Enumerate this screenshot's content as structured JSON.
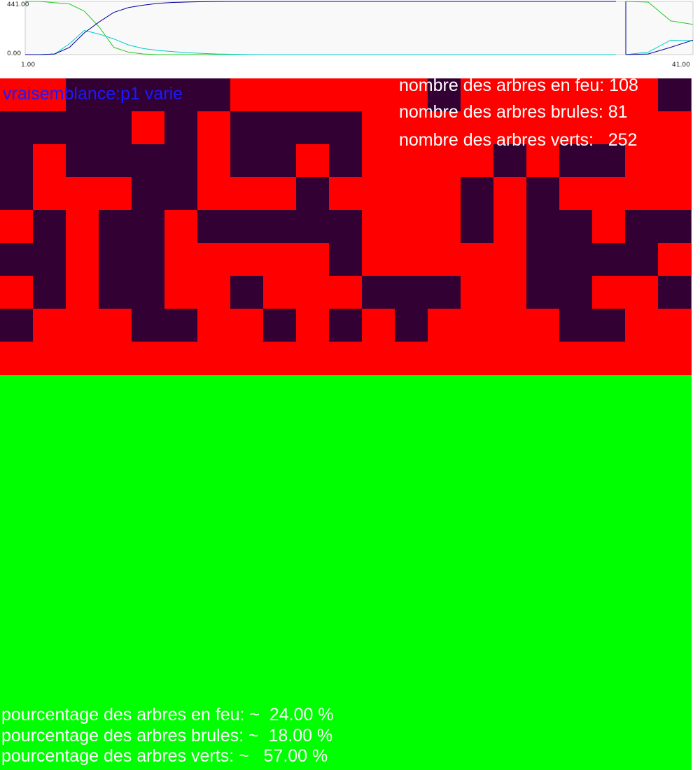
{
  "colors": {
    "fire": "#ff0000",
    "burned": "#330033",
    "green": "#00ff00",
    "title_text": "#1a1aff",
    "overlay_text": "#ffffff"
  },
  "title": "vraisemblance:p1 varie",
  "counts": {
    "fire": "nombre des arbres en feu: 108",
    "burned": "nombre des arbres brules: 81",
    "green": "nombre des arbres verts:   252"
  },
  "percentages": {
    "fire": "pourcentage des arbres en feu: ~  24.00 %",
    "burned": "pourcentage des arbres brules: ~  18.00 %",
    "green": "pourcentage des arbres verts: ~   57.00 %"
  },
  "grid": {
    "cols": 21,
    "rows": [
      "FFBBBBBFFFFFFBFFFFFFB",
      "BBBBFBFBBBBFFFFFFFFFF",
      "BFBBBBFBBFBFFFFBFBBFF",
      "BFFFBBFFFBFFFFBFBFFFF",
      "FBFBBFBBBBBFFFBFBBFBB",
      "BBFBBFFFFFBFFFFFBBBBF",
      "FBFBBFFBFFFBBBFFBBFFB",
      "BFFFBBFFBFBFBFFFFBBFF",
      "FFFFFFFFFFFFFFFFFFFFF"
    ]
  },
  "chart_data": {
    "type": "line",
    "ylim": [
      0,
      441
    ],
    "xlim": [
      1,
      41
    ],
    "y_ticks": [
      "441.00",
      "0.00"
    ],
    "x_ticks": [
      "1.00",
      "41.00"
    ],
    "series": [
      {
        "color": "#22cc22",
        "x": [
          1,
          2,
          3,
          4,
          5,
          6,
          7,
          8,
          9,
          10,
          11,
          12,
          13,
          14,
          15,
          16,
          17,
          18,
          19,
          20,
          21,
          22,
          23,
          24,
          25,
          26,
          27,
          28,
          29,
          30,
          31,
          32,
          33,
          34,
          35,
          36,
          37,
          38,
          39,
          40,
          41
        ],
        "y": [
          441,
          441,
          430,
          420,
          360,
          230,
          60,
          20,
          5,
          0,
          0,
          0,
          0,
          0,
          0,
          0,
          0,
          0,
          0,
          0,
          0,
          0,
          0,
          0,
          0,
          0,
          0,
          0,
          0,
          0,
          0,
          0,
          0,
          0,
          0,
          0,
          0,
          0,
          0,
          0,
          0
        ]
      },
      {
        "color": "#00cccc",
        "x": [
          1,
          2,
          3,
          4,
          5,
          6,
          7,
          8,
          9,
          10,
          11,
          12,
          13,
          14,
          15,
          16,
          17,
          18,
          19,
          20,
          21,
          22,
          23,
          24,
          25,
          26,
          27,
          28,
          29,
          30,
          31,
          32,
          33,
          34,
          35,
          36,
          37,
          38,
          39,
          40,
          41
        ],
        "y": [
          0,
          0,
          5,
          90,
          200,
          170,
          130,
          80,
          50,
          35,
          25,
          15,
          10,
          5,
          3,
          1,
          0,
          0,
          0,
          0,
          0,
          0,
          0,
          0,
          0,
          0,
          0,
          0,
          0,
          0,
          0,
          0,
          0,
          0,
          0,
          0,
          0,
          0,
          0,
          0,
          0
        ]
      },
      {
        "color": "#000099",
        "x": [
          1,
          2,
          3,
          4,
          5,
          6,
          7,
          8,
          9,
          10,
          11,
          12,
          13,
          14,
          15,
          16,
          17,
          18,
          19,
          20,
          21,
          22,
          23,
          24,
          25,
          26,
          27,
          28,
          29,
          30,
          31,
          32,
          33,
          34,
          35,
          36,
          37,
          38,
          39,
          40,
          41
        ],
        "y": [
          0,
          0,
          5,
          60,
          180,
          270,
          350,
          390,
          410,
          425,
          432,
          436,
          439,
          440,
          441,
          441,
          441,
          441,
          441,
          441,
          441,
          441,
          441,
          441,
          441,
          441,
          441,
          441,
          441,
          441,
          441,
          441,
          441,
          441,
          441,
          441,
          441,
          441,
          441,
          441,
          441
        ]
      }
    ],
    "restart_series": [
      {
        "color": "#22cc22",
        "x": [
          1,
          2,
          3,
          4
        ],
        "y": [
          441,
          435,
          280,
          250
        ]
      },
      {
        "color": "#00cccc",
        "x": [
          1,
          2,
          3,
          4
        ],
        "y": [
          0,
          20,
          120,
          115
        ]
      },
      {
        "color": "#000099",
        "x": [
          1,
          2,
          3,
          4
        ],
        "y": [
          0,
          5,
          60,
          120
        ]
      }
    ]
  }
}
